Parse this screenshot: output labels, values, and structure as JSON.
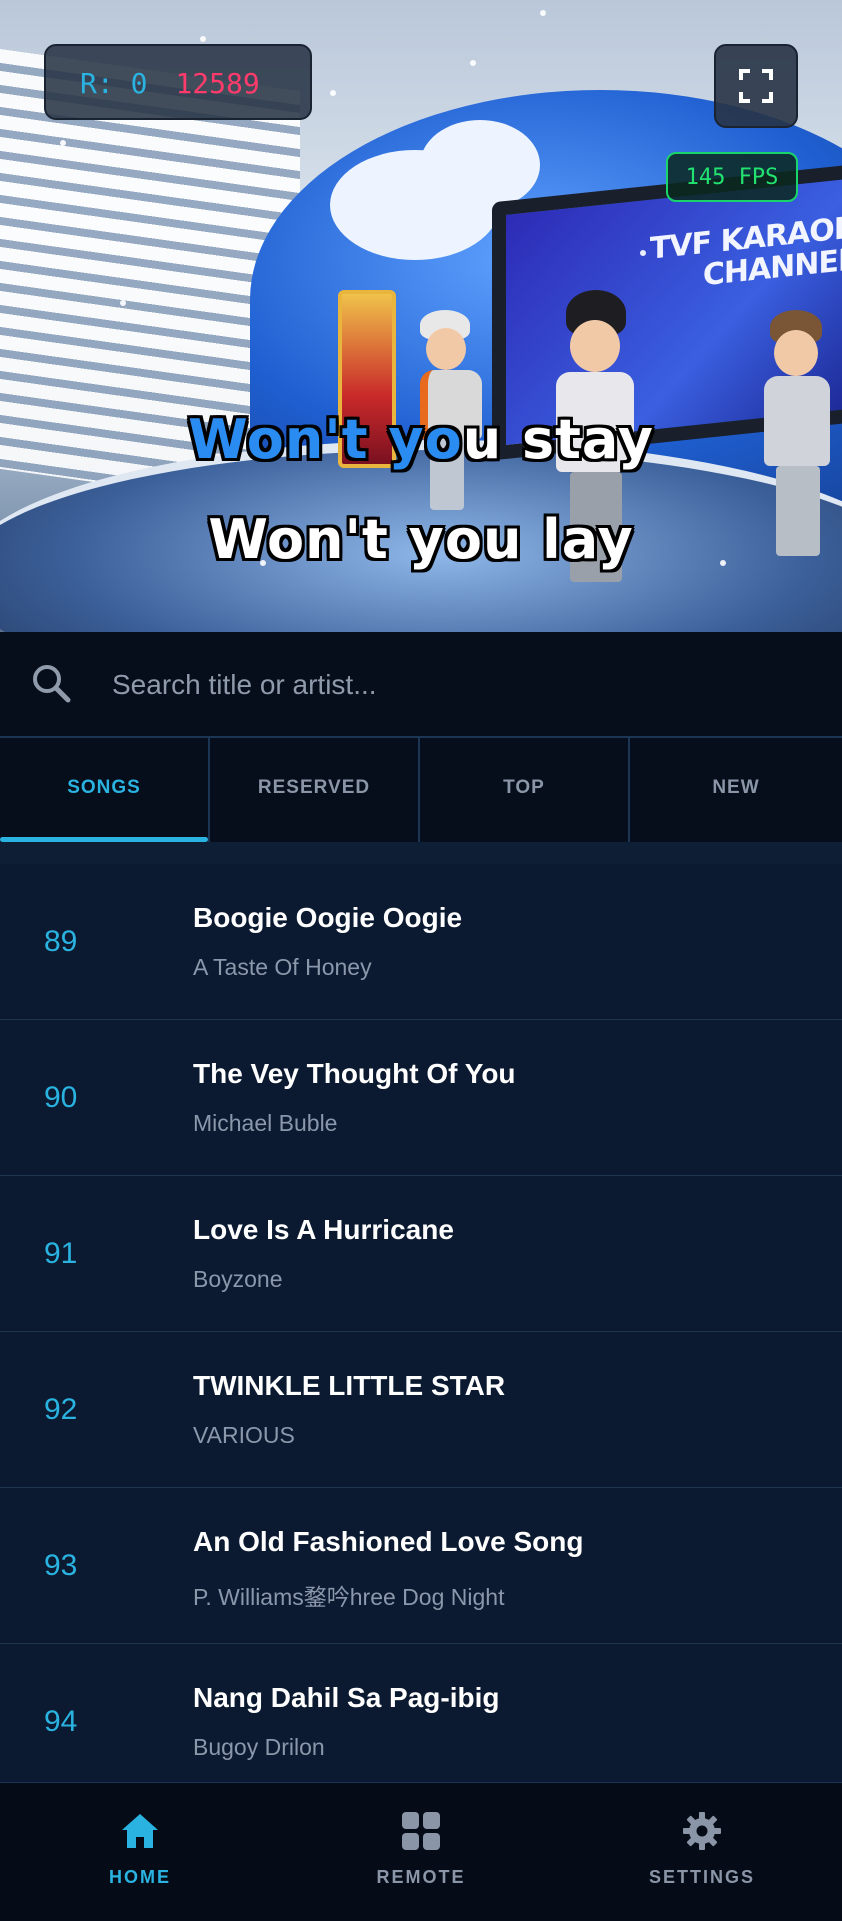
{
  "overlay": {
    "score_label": "R:",
    "reserved_count": "0",
    "score": "12589",
    "fps": "145 FPS",
    "screen_text_line1": "TVF KARAOK",
    "screen_text_line2": "CHANNEL"
  },
  "lyrics": {
    "line1_sung": "Won't yo",
    "line1_rest": "u stay",
    "line2": "Won't you lay"
  },
  "search": {
    "placeholder": "Search title or artist..."
  },
  "tabs": [
    {
      "label": "SONGS",
      "active": true
    },
    {
      "label": "RESERVED",
      "active": false
    },
    {
      "label": "TOP",
      "active": false
    },
    {
      "label": "NEW",
      "active": false
    }
  ],
  "songs": [
    {
      "number": "89",
      "title": "Boogie Oogie Oogie",
      "artist": "A Taste Of Honey"
    },
    {
      "number": "90",
      "title": "The Vey Thought Of You",
      "artist": "Michael Buble"
    },
    {
      "number": "91",
      "title": "Love Is A Hurricane",
      "artist": "Boyzone"
    },
    {
      "number": "92",
      "title": "TWINKLE LITTLE STAR",
      "artist": "VARIOUS"
    },
    {
      "number": "93",
      "title": "An Old Fashioned Love Song",
      "artist": "P. Williams鍪吟hree Dog Night"
    },
    {
      "number": "94",
      "title": "Nang Dahil Sa Pag-ibig",
      "artist": "Bugoy Drilon"
    }
  ],
  "nav": [
    {
      "label": "HOME",
      "icon": "home-icon",
      "active": true
    },
    {
      "label": "REMOTE",
      "icon": "grid-icon",
      "active": false
    },
    {
      "label": "SETTINGS",
      "icon": "gear-icon",
      "active": false
    }
  ],
  "colors": {
    "accent": "#2ab3e0",
    "score": "#ff3b6b",
    "fps": "#22e36f",
    "background": "#0b1a30"
  }
}
